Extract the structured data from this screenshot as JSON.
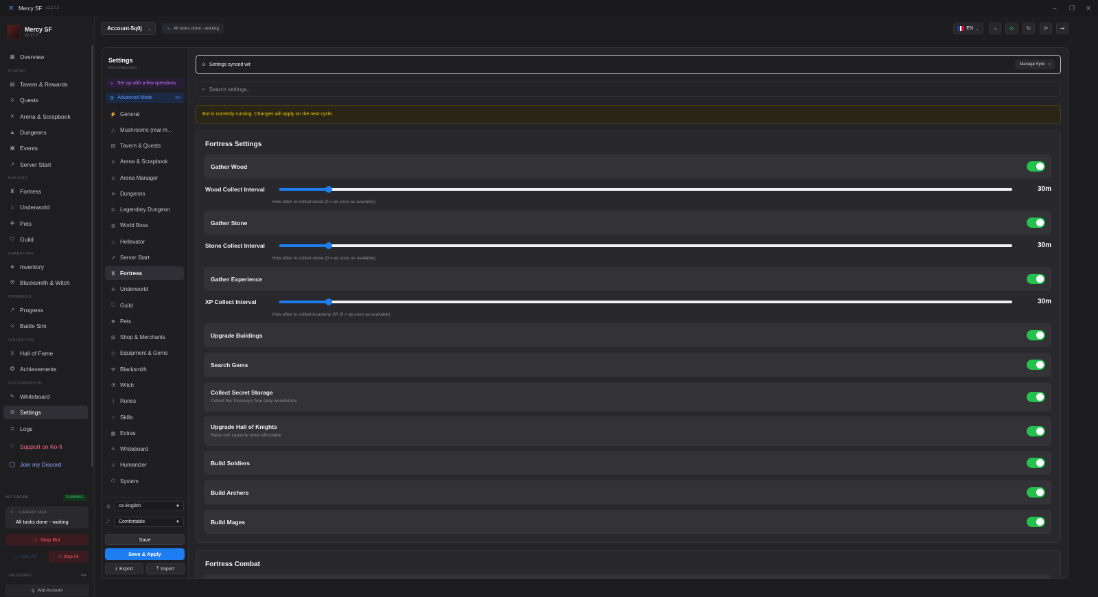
{
  "window": {
    "title": "Mercy SF",
    "version": "v2.17.2",
    "controls": [
      "–",
      "❐",
      "✕"
    ]
  },
  "brand": {
    "name": "Mercy SF",
    "version": "v2.17.2"
  },
  "sidebar": {
    "overview": "Overview",
    "sections": {
      "playing": "PLAYING",
      "building": "BUILDING",
      "character": "CHARACTER",
      "progress": "PROGRESS",
      "collection": "COLLECTION",
      "customization": "CUSTOMIZATION"
    },
    "items": {
      "tavern": "Tavern & Rewards",
      "quests": "Quests",
      "arena": "Arena & Scrapbook",
      "dungeons": "Dungeons",
      "events": "Events",
      "server_start": "Server Start",
      "fortress": "Fortress",
      "underworld": "Underworld",
      "pets": "Pets",
      "guild": "Guild",
      "inventory": "Inventory",
      "blacksmith": "Blacksmith & Witch",
      "progress": "Progress",
      "battle_sim": "Battle Sim",
      "hall_of_fame": "Hall of Fame",
      "achievements": "Achievements",
      "whiteboard": "Whiteboard",
      "settings": "Settings",
      "logs": "Logs"
    },
    "kofi": "Support on Ko-fi",
    "discord": "Join my Discord",
    "engine_label": "BOT ENGINE",
    "engine_status": "RUNNING",
    "current_task_label": "CURRENT TASK",
    "current_task": "All tasks done - waiting",
    "stop_bot": "Stop Bot",
    "start_all": "Start All",
    "stop_all": "Stop All",
    "accounts_label": "ACCOUNTS",
    "accounts_count": "4/4",
    "add_account": "Add Account"
  },
  "topbar": {
    "account": "Account-5q0j",
    "task_status": "All tasks done - waiting",
    "language": "EN"
  },
  "settings_nav": {
    "title": "Settings",
    "subtitle": "Bot configuration",
    "setup": "Set up with a few questions",
    "advanced": "Advanced Mode",
    "advanced_state": "ON",
    "items": {
      "general": "General",
      "mushrooms": "Mushrooms (real m...",
      "tavern": "Tavern & Quests",
      "arena": "Arena & Scrapbook",
      "arena_manager": "Arena Manager",
      "dungeons": "Dungeons",
      "legendary": "Legendary Dungeon",
      "world_boss": "World Boss",
      "hellevator": "Hellevator",
      "server_start": "Server Start",
      "fortress": "Fortress",
      "underworld": "Underworld",
      "guild": "Guild",
      "pets": "Pets",
      "shop": "Shop & Merchants",
      "equipment": "Equipment & Gems",
      "blacksmith": "Blacksmith",
      "witch": "Witch",
      "runes": "Runes",
      "skills": "Skills",
      "extras": "Extras",
      "whiteboard": "Whiteboard",
      "humanizer": "Humanizer",
      "system": "System"
    },
    "language_select": "ca English",
    "density_select": "Comfortable",
    "save": "Save",
    "save_apply": "Save & Apply",
    "export": "Export",
    "import": "Import"
  },
  "content": {
    "sync_text": "Settings synced wit",
    "manage_sync": "Manage Sync",
    "search_placeholder": "Search settings...",
    "warning": "Bot is currently running. Changes will apply on the next cycle.",
    "fortress_title": "Fortress Settings",
    "gather_wood": "Gather Wood",
    "wood_interval": {
      "label": "Wood Collect Interval",
      "value": "30m",
      "fraction": 0.067,
      "help": "How often to collect wood (0 = as soon as available)"
    },
    "gather_stone": "Gather Stone",
    "stone_interval": {
      "label": "Stone Collect Interval",
      "value": "30m",
      "fraction": 0.067,
      "help": "How often to collect stone (0 = as soon as available)"
    },
    "gather_xp": "Gather Experience",
    "xp_interval": {
      "label": "XP Collect Interval",
      "value": "30m",
      "fraction": 0.067,
      "help": "How often to collect Academy XP (0 = as soon as available)"
    },
    "upgrade_buildings": "Upgrade Buildings",
    "search_gems": "Search Gems",
    "secret_storage": {
      "label": "Collect Secret Storage",
      "desc": "Collect the Treasury's free daily wood/stone"
    },
    "hall_of_knights": {
      "label": "Upgrade Hall of Knights",
      "desc": "Raise unit capacity when affordable"
    },
    "build_soldiers": "Build Soldiers",
    "build_archers": "Build Archers",
    "build_mages": "Build Mages",
    "combat_title": "Fortress Combat"
  }
}
